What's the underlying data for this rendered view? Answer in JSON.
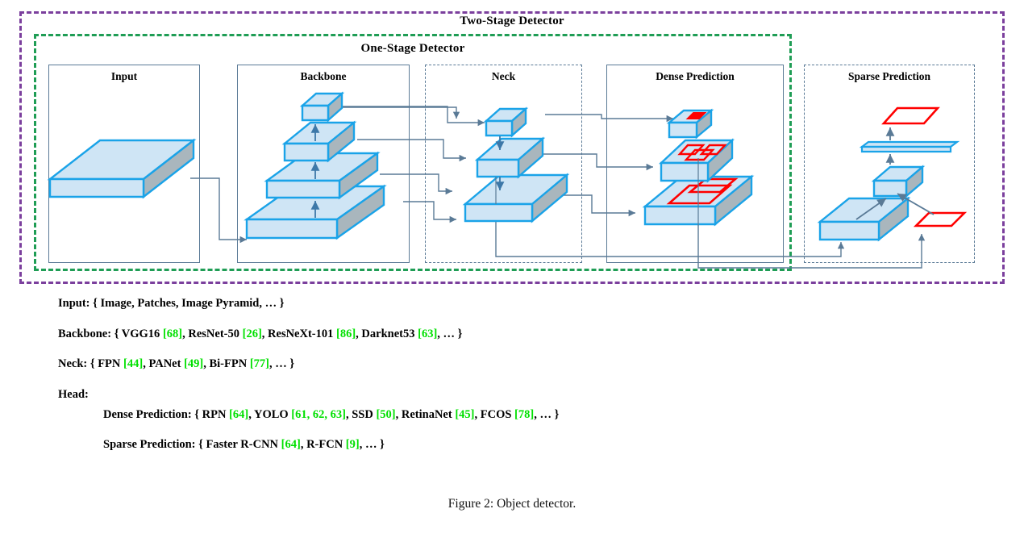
{
  "figure": {
    "caption": "Figure 2: Object detector."
  },
  "frames": {
    "two_stage": {
      "label": "Two-Stage Detector",
      "color": "#7b3f9d",
      "style": "dashed"
    },
    "one_stage": {
      "label": "One-Stage Detector",
      "color": "#1f9d55",
      "style": "dashed"
    }
  },
  "panels": [
    {
      "id": "input",
      "label": "Input",
      "style": "solid"
    },
    {
      "id": "backbone",
      "label": "Backbone",
      "style": "solid"
    },
    {
      "id": "neck",
      "label": "Neck",
      "style": "dashed"
    },
    {
      "id": "dense",
      "label": "Dense Prediction",
      "style": "solid"
    },
    {
      "id": "sparse",
      "label": "Sparse Prediction",
      "style": "dashed"
    }
  ],
  "colors": {
    "slab_fill": "#cfe5f5",
    "slab_edge": "#1aa3e8",
    "slab_side": "#a9b6bd",
    "box_red": "#ff0000",
    "arrow": "#5a7a96",
    "panel_border": "#5a7a96",
    "reference_green": "#00e000",
    "two_stage_purple": "#7b3f9d",
    "one_stage_green": "#1f9d55"
  },
  "spec": {
    "input": {
      "prefix": "Input: { Image, Patches, Image Pyramid, … }"
    },
    "backbone": {
      "label": "Backbone: {",
      "items": [
        {
          "name": "VGG16",
          "ref": "[68]"
        },
        {
          "name": "ResNet-50",
          "ref": "[26]"
        },
        {
          "name": "ResNeXt-101",
          "ref": "[86]"
        },
        {
          "name": "Darknet53",
          "ref": "[63]"
        }
      ],
      "tail": ", … }"
    },
    "neck": {
      "label": "Neck: {",
      "items": [
        {
          "name": "FPN",
          "ref": "[44]"
        },
        {
          "name": "PANet",
          "ref": "[49]"
        },
        {
          "name": "Bi-FPN",
          "ref": "[77]"
        }
      ],
      "tail": ", … }"
    },
    "head": {
      "label": "Head:",
      "dense": {
        "label": "Dense Prediction: {",
        "items": [
          {
            "name": "RPN",
            "ref": "[64]"
          },
          {
            "name": "YOLO",
            "ref": "[61, 62, 63]"
          },
          {
            "name": "SSD",
            "ref": "[50]"
          },
          {
            "name": "RetinaNet",
            "ref": "[45]"
          },
          {
            "name": "FCOS",
            "ref": "[78]"
          }
        ],
        "tail": ", … }"
      },
      "sparse": {
        "label": "Sparse Prediction: {",
        "items": [
          {
            "name": "Faster R-CNN",
            "ref": "[64]"
          },
          {
            "name": " R-FCN",
            "ref": "[9]"
          }
        ],
        "tail": ", … }"
      }
    }
  },
  "diagram": {
    "input_slabs": 1,
    "backbone_slabs": 4,
    "neck_slabs": 3,
    "dense_slabs": 3,
    "sparse_nodes": 5,
    "backbone_arrow_direction": "up",
    "neck_arrow_direction": "down",
    "sparse_arrow_direction": "up"
  }
}
